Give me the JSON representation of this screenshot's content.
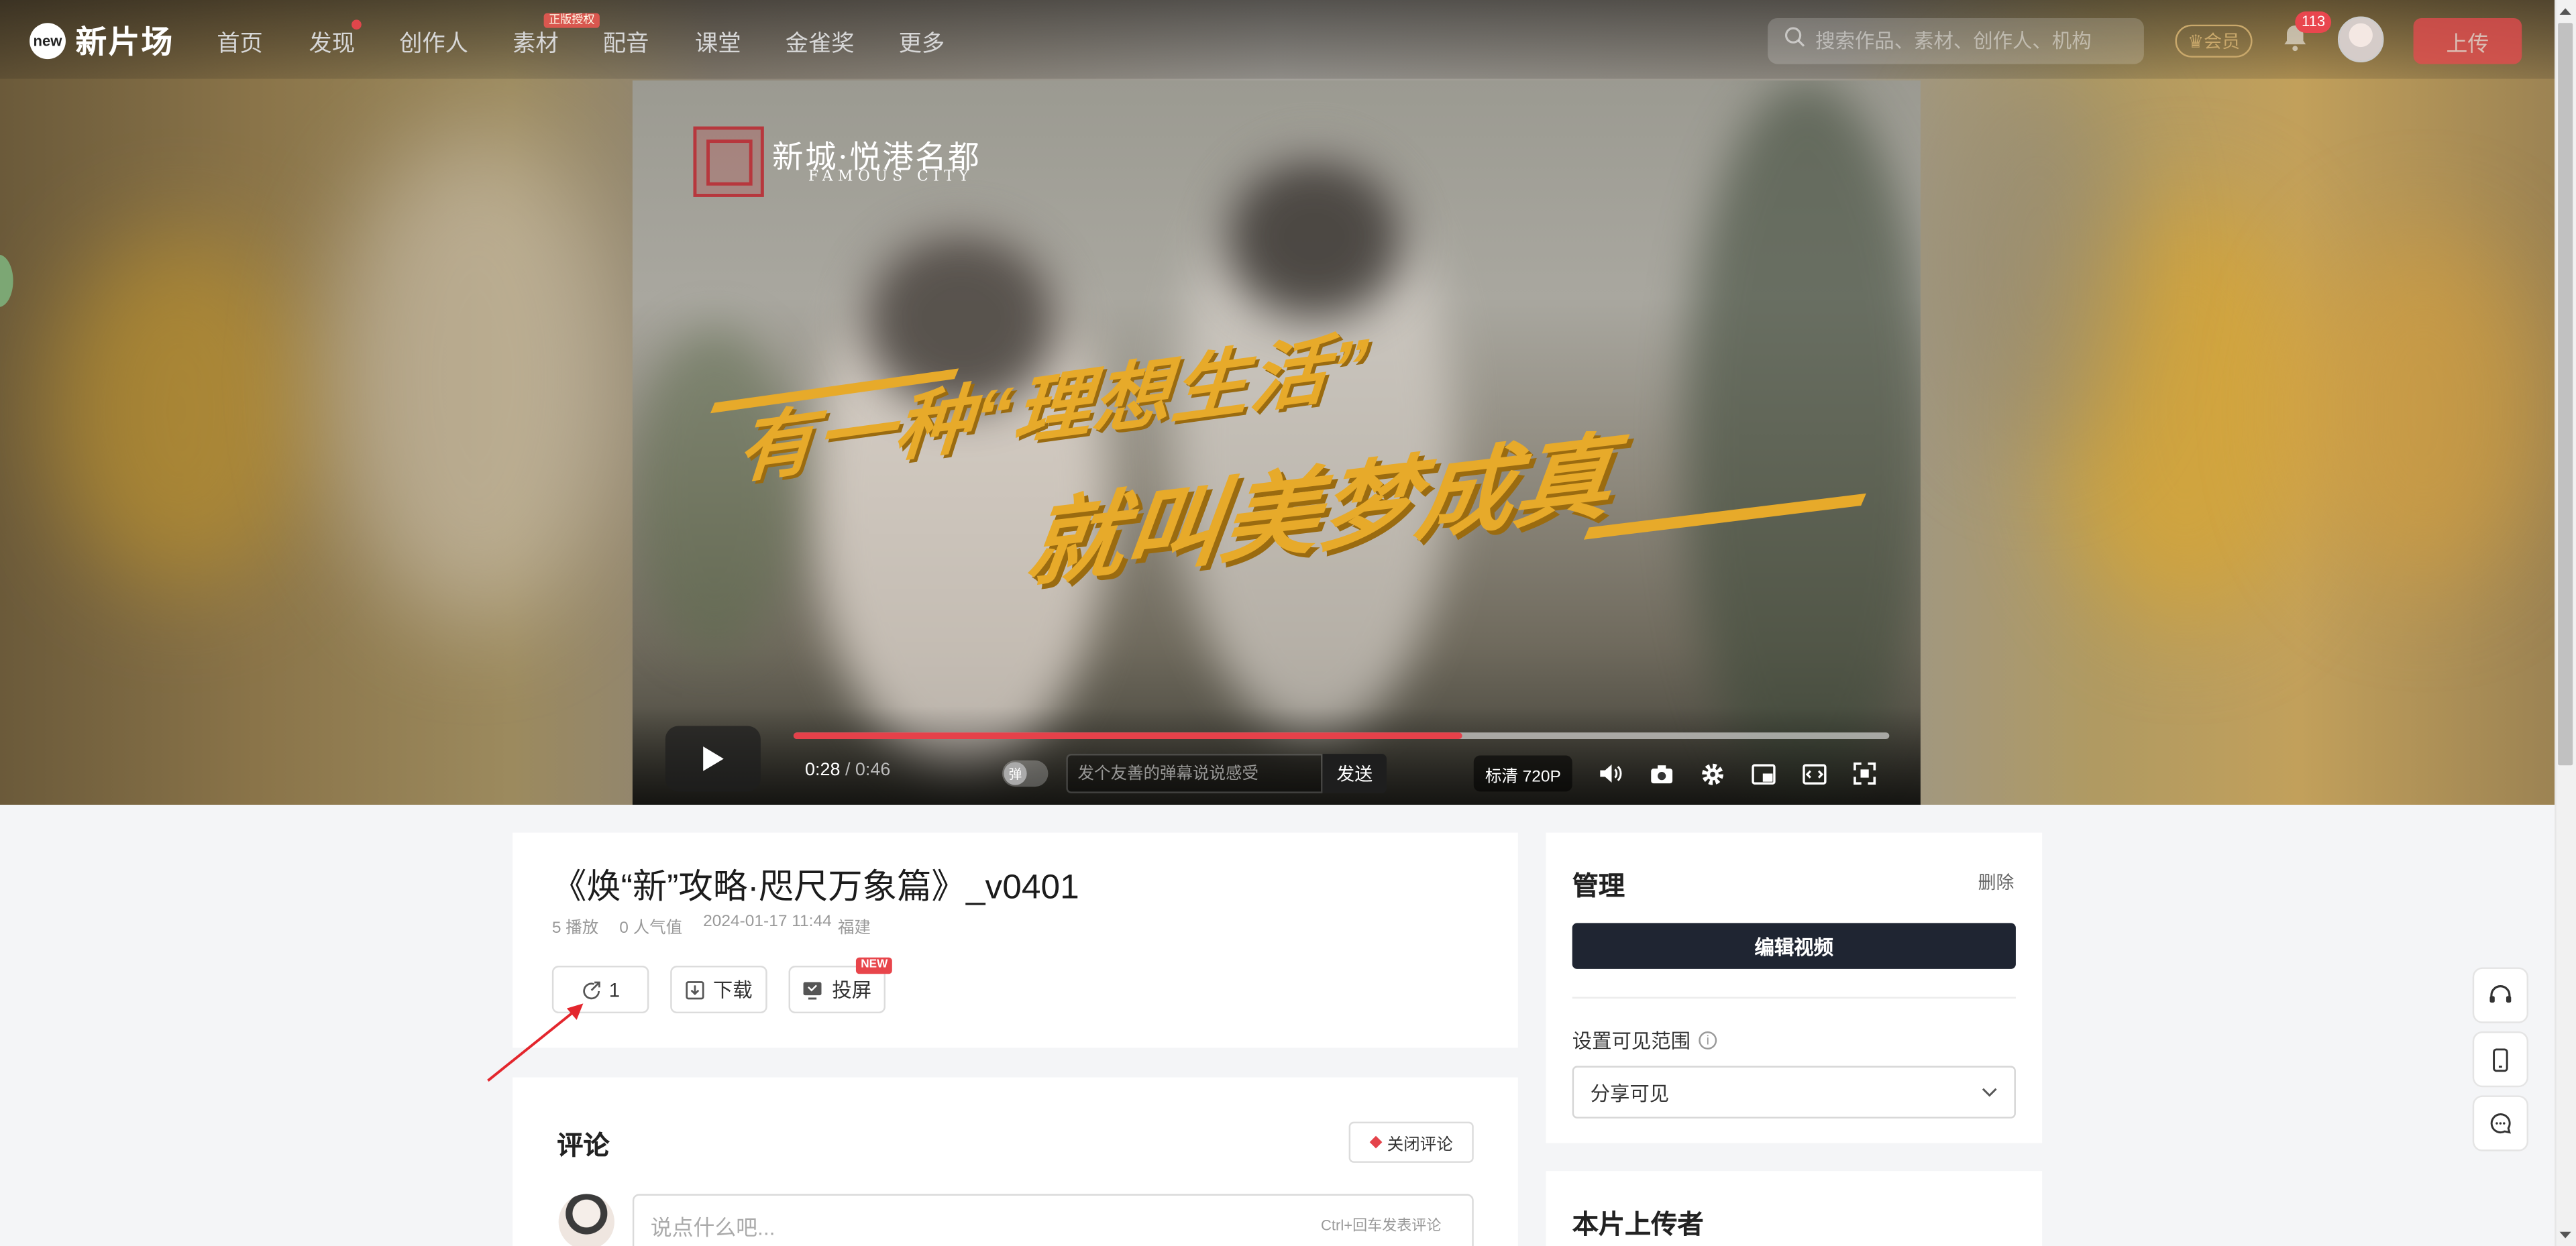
{
  "header": {
    "logo_mark": "new",
    "logo_text": "新片场",
    "nav": [
      {
        "label": "首页"
      },
      {
        "label": "发现"
      },
      {
        "label": "创作人"
      },
      {
        "label": "素材"
      },
      {
        "label": "配音"
      },
      {
        "label": "课堂"
      },
      {
        "label": "金雀奖"
      },
      {
        "label": "更多"
      }
    ],
    "material_badge": "正版授权",
    "search_placeholder": "搜索作品、素材、创作人、机构",
    "vip_label": "会员",
    "notification_count": "113",
    "upload_label": "上传"
  },
  "video": {
    "brand_name": "新城·悦港名都",
    "brand_en": "FAMOUS CITY",
    "slogan_line1": "有一种“理想生活”",
    "slogan_line2": "就叫美梦成真",
    "current_time": "0:28",
    "separator": " / ",
    "total_time": "0:46",
    "progress": 0.61,
    "danmaku_toggle_label": "弹",
    "danmaku_placeholder": "发个友善的弹幕说说感受",
    "send_label": "发送",
    "quality": "标清 720P"
  },
  "info": {
    "title": "《焕“新”攻略·咫尺万象篇》_v0401",
    "plays": "5 播放",
    "popularity": "0 人气值",
    "date": "2024-01-17 11:44",
    "location": "福建",
    "share_count": "1",
    "download_label": "下载",
    "cast_label": "投屏",
    "new_tag": "NEW"
  },
  "comments": {
    "heading": "评论",
    "close_label": "关闭评论",
    "input_placeholder": "说点什么吧...",
    "hint": "Ctrl+回车发表评论"
  },
  "manage": {
    "heading": "管理",
    "delete_label": "删除",
    "edit_label": "编辑视频",
    "visibility_label": "设置可见范围",
    "visibility_value": "分享可见",
    "uploader_heading": "本片上传者"
  },
  "colors": {
    "accent_red": "#e5414a",
    "dark_button": "#1f2532",
    "slogan_gold": "#e7aa2a"
  }
}
